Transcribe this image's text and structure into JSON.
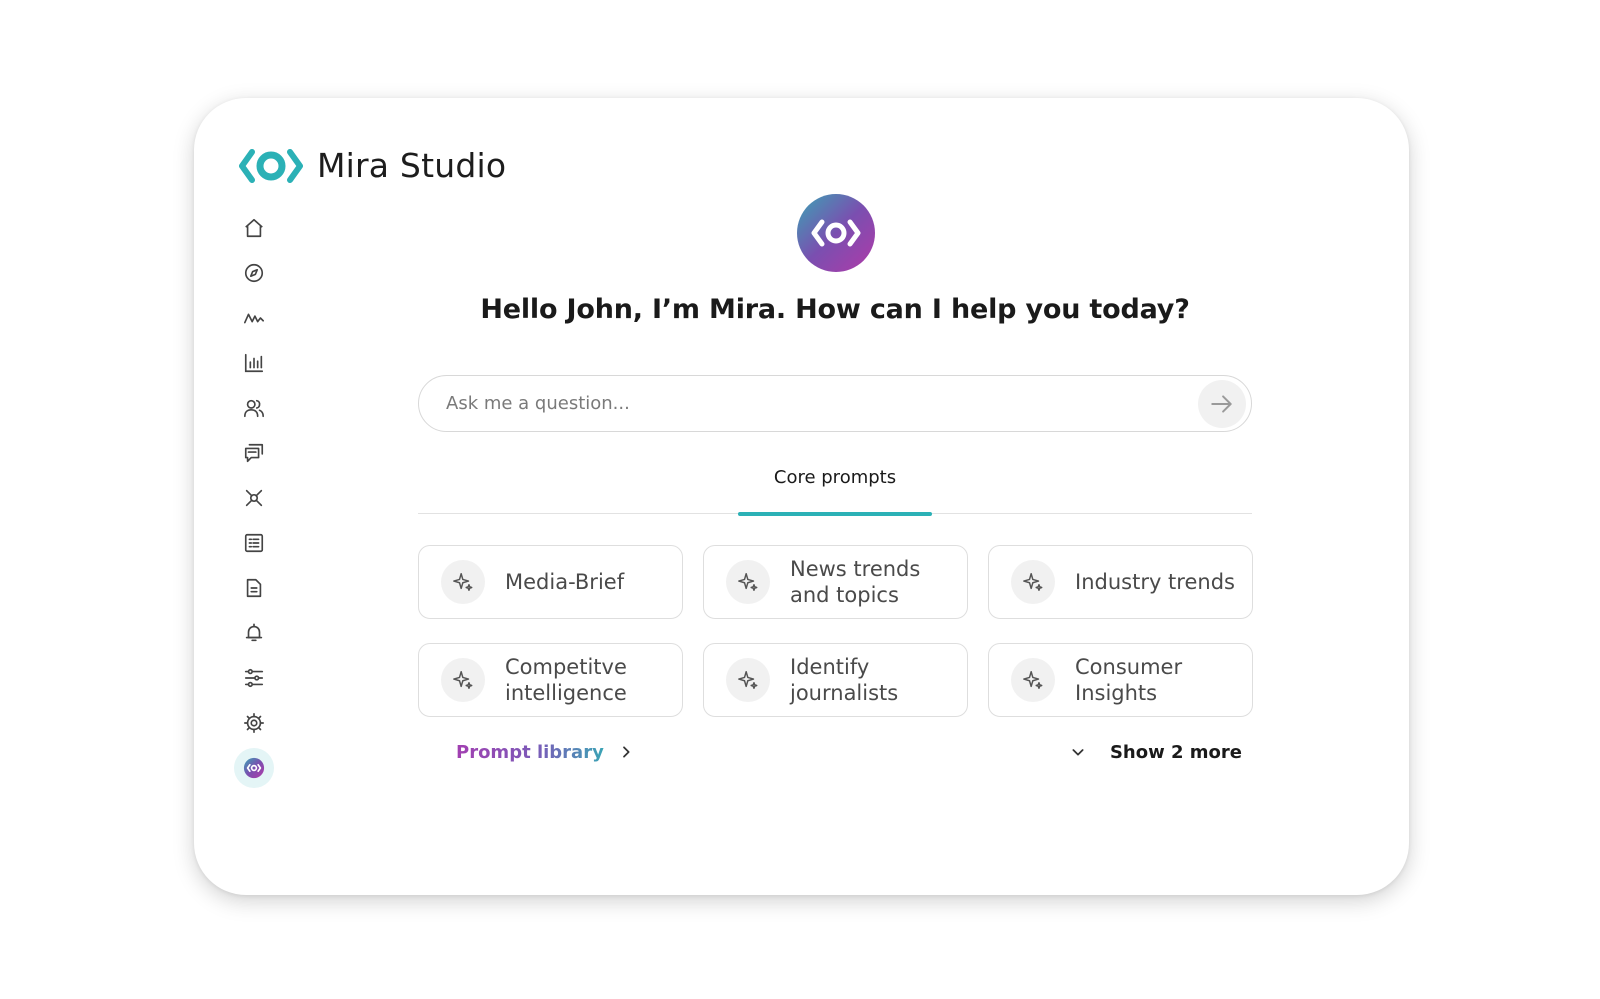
{
  "app": {
    "title": "Mira Studio",
    "logo_icon": "mira-eye-logo"
  },
  "colors": {
    "accent": "#2bb1b6",
    "purple": "#a23fb1",
    "card_border": "#dedede"
  },
  "sidebar": {
    "items": [
      {
        "name": "home",
        "icon": "home-icon"
      },
      {
        "name": "explore",
        "icon": "compass-icon"
      },
      {
        "name": "activity",
        "icon": "activity-icon"
      },
      {
        "name": "analytics",
        "icon": "bar-chart-icon"
      },
      {
        "name": "people",
        "icon": "users-icon"
      },
      {
        "name": "conversations",
        "icon": "chat-icon"
      },
      {
        "name": "network",
        "icon": "network-icon"
      },
      {
        "name": "lists",
        "icon": "list-document-icon"
      },
      {
        "name": "reports",
        "icon": "file-icon"
      },
      {
        "name": "alerts",
        "icon": "bell-icon"
      },
      {
        "name": "filters",
        "icon": "sliders-icon"
      },
      {
        "name": "settings",
        "icon": "gear-icon"
      },
      {
        "name": "mira",
        "icon": "mira-icon",
        "active": true
      }
    ]
  },
  "greeting": {
    "name_part": "Hello John",
    "rest": ", I’m Mira. How can I help you today?"
  },
  "search": {
    "placeholder": "Ask me a question...",
    "value": ""
  },
  "tabs": [
    {
      "label": "Core prompts",
      "active": true
    }
  ],
  "prompts": [
    {
      "label": "Media-Brief"
    },
    {
      "label": "News trends and topics"
    },
    {
      "label": "Industry trends"
    },
    {
      "label": "Competitve intelligence"
    },
    {
      "label": "Identify journalists"
    },
    {
      "label": "Consumer Insights"
    }
  ],
  "footer": {
    "library_label": "Prompt library",
    "show_more_label": "Show 2 more"
  }
}
